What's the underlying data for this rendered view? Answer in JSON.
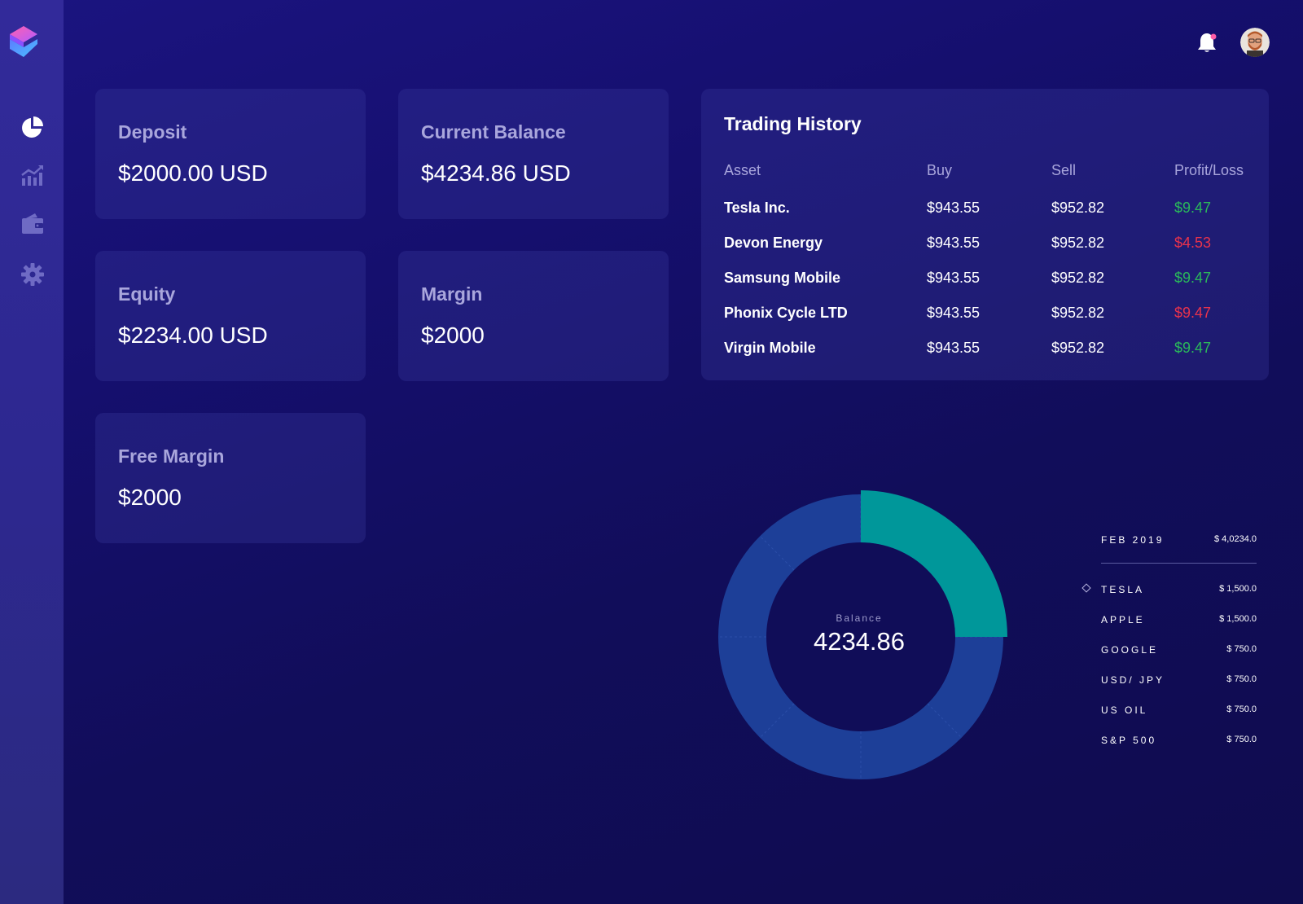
{
  "colors": {
    "accent_teal": "#00979a",
    "ring_blue": "#1d3f98",
    "profit_green": "#2ab95a",
    "loss_red": "#e8334c",
    "label_lavender": "#a9a6dc"
  },
  "sidebar": {
    "logo": "brand-logo",
    "items": [
      {
        "name": "dashboard",
        "icon": "pie-chart-icon"
      },
      {
        "name": "analytics",
        "icon": "line-chart-icon"
      },
      {
        "name": "wallet",
        "icon": "wallet-icon"
      },
      {
        "name": "settings",
        "icon": "gear-icon"
      }
    ]
  },
  "header": {
    "notification_icon": "bell-icon",
    "has_unread": true
  },
  "stats": {
    "deposit": {
      "label": "Deposit",
      "value": "$2000.00 USD"
    },
    "current_balance": {
      "label": "Current Balance",
      "value": "$4234.86 USD"
    },
    "equity": {
      "label": "Equity",
      "value": "$2234.00 USD"
    },
    "margin": {
      "label": "Margin",
      "value": "$2000"
    },
    "free_margin": {
      "label": "Free Margin",
      "value": "$2000"
    }
  },
  "trading_history": {
    "title": "Trading History",
    "columns": [
      "Asset",
      "Buy",
      "Sell",
      "Profit/Loss"
    ],
    "rows": [
      {
        "asset": "Tesla Inc.",
        "buy": "$943.55",
        "sell": "$952.82",
        "pl": "$9.47",
        "status": "profit"
      },
      {
        "asset": "Devon Energy",
        "buy": "$943.55",
        "sell": "$952.82",
        "pl": "$4.53",
        "status": "loss"
      },
      {
        "asset": "Samsung Mobile",
        "buy": "$943.55",
        "sell": "$952.82",
        "pl": "$9.47",
        "status": "profit"
      },
      {
        "asset": "Phonix Cycle LTD",
        "buy": "$943.55",
        "sell": "$952.82",
        "pl": "$9.47",
        "status": "loss"
      },
      {
        "asset": "Virgin Mobile",
        "buy": "$943.55",
        "sell": "$952.82",
        "pl": "$9.47",
        "status": "profit"
      }
    ]
  },
  "balance_chart": {
    "caption": "Balance",
    "value": "4234.86",
    "highlight_fraction": 0.25,
    "legend": {
      "period": "FEB 2019",
      "total": "$ 4,0234.0",
      "selected": "TESLA",
      "items": [
        {
          "name": "TESLA",
          "amount": "$ 1,500.0"
        },
        {
          "name": "APPLE",
          "amount": "$ 1,500.0"
        },
        {
          "name": "GOOGLE",
          "amount": "$ 750.0"
        },
        {
          "name": "USD/ JPY",
          "amount": "$ 750.0"
        },
        {
          "name": "US OIL",
          "amount": "$ 750.0"
        },
        {
          "name": "S&P 500",
          "amount": "$ 750.0"
        }
      ]
    }
  }
}
